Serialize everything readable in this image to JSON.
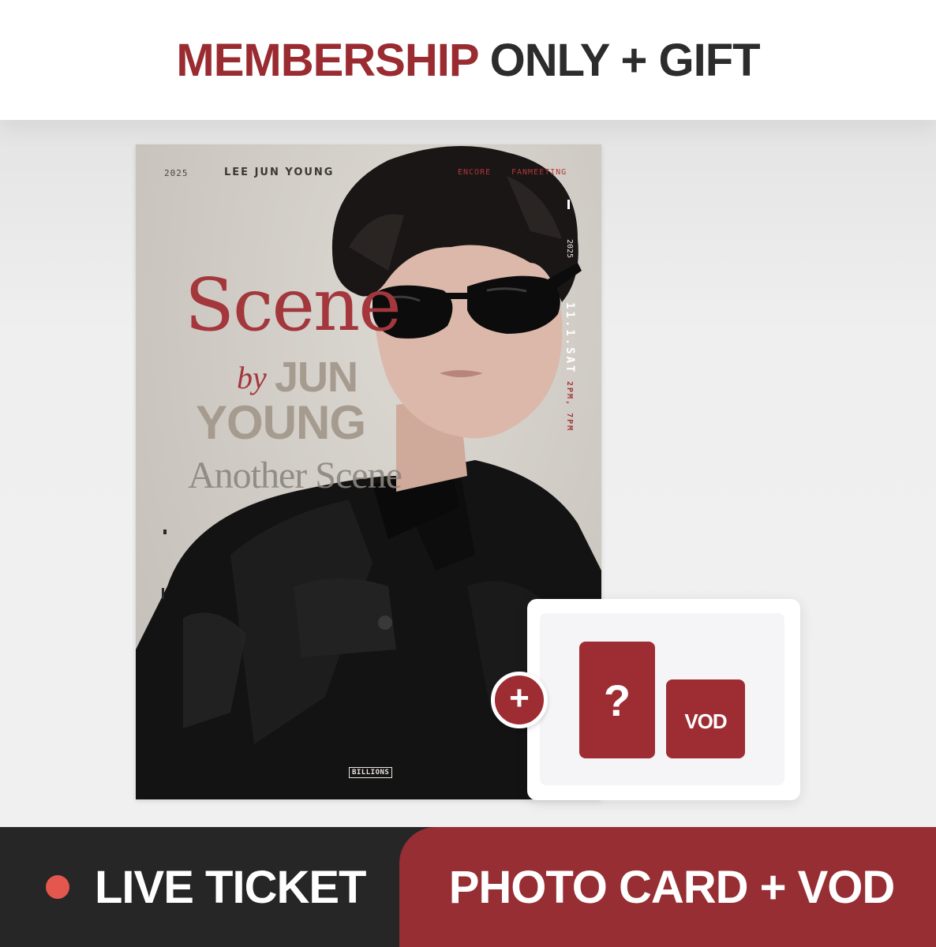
{
  "header": {
    "title_accent": "MEMBERSHIP",
    "title_rest": "ONLY + GIFT"
  },
  "poster": {
    "year": "2025",
    "artist": "LEE JUN YOUNG",
    "encore": "ENCORE",
    "fanmeeting": "FANMEETING",
    "title_scene": "Scene",
    "title_by": "by",
    "title_jun": "JUN",
    "title_young": "YOUNG",
    "subtitle": "Another Scene",
    "date": "11.1.SAT",
    "date_year": "2025",
    "time": "2PM, 7PM",
    "logo": "BILLIONS"
  },
  "gift": {
    "plus": "+",
    "photo_card": "?",
    "vod": "VOD"
  },
  "bottom": {
    "left_label": "LIVE TICKET",
    "right_label": "PHOTO CARD + VOD"
  },
  "colors": {
    "accent": "#9a2b30",
    "dark_bar": "#262626",
    "live_dot": "#e4574f"
  }
}
